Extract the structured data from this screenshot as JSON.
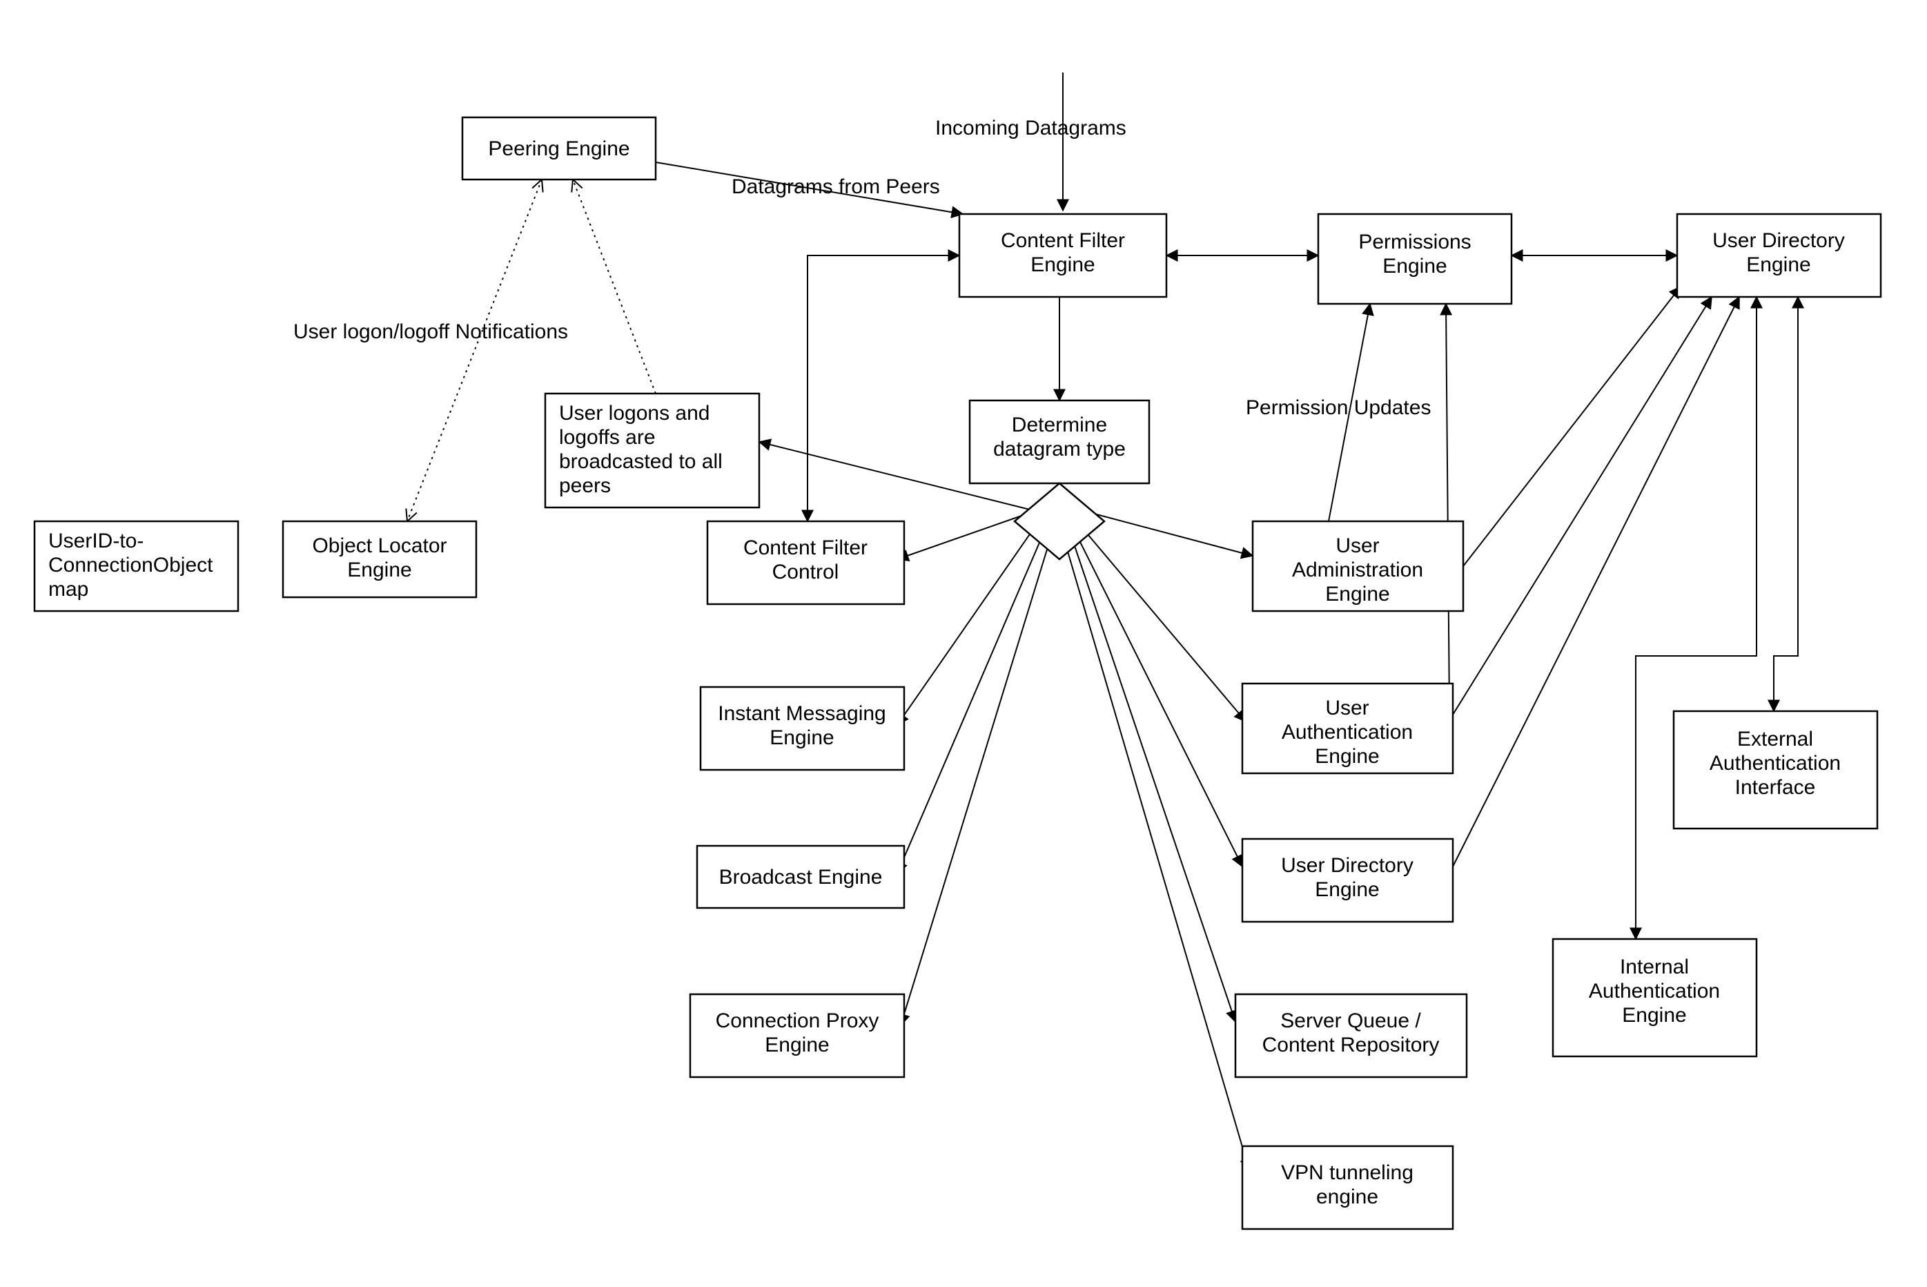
{
  "nodes": {
    "peering_engine": {
      "label": "Peering Engine"
    },
    "userid_map": {
      "label": "UserID-to-ConnectionObject map"
    },
    "object_locator": {
      "label": "Object Locator Engine"
    },
    "broadcast_note": {
      "label": "User logons and logoffs are broadcasted to all peers"
    },
    "content_filter_engine": {
      "label": "Content Filter Engine"
    },
    "permissions_engine": {
      "label": "Permissions Engine"
    },
    "user_directory_engine": {
      "label": "User Directory Engine"
    },
    "determine_type": {
      "label": "Determine datagram type"
    },
    "content_filter_ctrl": {
      "label": "Content Filter Control"
    },
    "user_admin_engine": {
      "label": "User Administration Engine"
    },
    "instant_messaging": {
      "label": "Instant Messaging Engine"
    },
    "user_auth_engine": {
      "label": "User Authentication Engine"
    },
    "broadcast_engine": {
      "label": "Broadcast Engine"
    },
    "user_dir_engine_2": {
      "label": "User Directory Engine"
    },
    "connection_proxy": {
      "label": "Connection Proxy Engine"
    },
    "server_queue": {
      "label": "Server Queue / Content Repository"
    },
    "vpn_engine": {
      "label": "VPN tunneling engine"
    },
    "external_auth": {
      "label": "External Authentication Interface"
    },
    "internal_auth": {
      "label": "Internal Authentication Engine"
    }
  },
  "labels": {
    "incoming_datagrams": "Incoming Datagrams",
    "datagrams_from_peers": "Datagrams from Peers",
    "user_logon_notif": "User logon/logoff Notifications",
    "permission_updates": "Permission Updates"
  },
  "chart_data": {
    "type": "flow-diagram",
    "nodes": [
      "Peering Engine",
      "UserID-to-ConnectionObject map",
      "Object Locator Engine",
      "User logons and logoffs are broadcasted to all peers",
      "Content Filter Engine",
      "Permissions Engine",
      "User Directory Engine",
      "Determine datagram type",
      "Content Filter Control",
      "User Administration Engine",
      "Instant Messaging Engine",
      "User Authentication Engine",
      "Broadcast Engine",
      "User Directory Engine (2)",
      "Connection Proxy Engine",
      "Server Queue / Content Repository",
      "VPN tunneling engine",
      "External Authentication Interface",
      "Internal Authentication Engine"
    ],
    "edges": [
      {
        "from": "(external)",
        "to": "Content Filter Engine",
        "label": "Incoming Datagrams",
        "direction": "→"
      },
      {
        "from": "Peering Engine",
        "to": "Content Filter Engine",
        "label": "Datagrams from Peers",
        "direction": "→"
      },
      {
        "from": "Content Filter Engine",
        "to": "Determine datagram type",
        "direction": "→"
      },
      {
        "from": "Content Filter Engine",
        "to": "Permissions Engine",
        "direction": "↔"
      },
      {
        "from": "Permissions Engine",
        "to": "User Directory Engine",
        "direction": "↔"
      },
      {
        "from": "Content Filter Control",
        "to": "Content Filter Engine",
        "direction": "↔"
      },
      {
        "from": "Determine datagram type",
        "to": "Content Filter Control",
        "direction": "→"
      },
      {
        "from": "Determine datagram type",
        "to": "Instant Messaging Engine",
        "direction": "→"
      },
      {
        "from": "Determine datagram type",
        "to": "Broadcast Engine",
        "direction": "→"
      },
      {
        "from": "Determine datagram type",
        "to": "Connection Proxy Engine",
        "direction": "→"
      },
      {
        "from": "Determine datagram type",
        "to": "User Administration Engine",
        "direction": "→"
      },
      {
        "from": "Determine datagram type",
        "to": "User Authentication Engine",
        "direction": "→"
      },
      {
        "from": "Determine datagram type",
        "to": "User Directory Engine (2)",
        "direction": "→"
      },
      {
        "from": "Determine datagram type",
        "to": "Server Queue / Content Repository",
        "direction": "→"
      },
      {
        "from": "Determine datagram type",
        "to": "VPN tunneling engine",
        "direction": "→"
      },
      {
        "from": "Determine datagram type",
        "to": "User logons and logoffs are broadcasted to all peers",
        "direction": "→"
      },
      {
        "from": "User Administration Engine",
        "to": "Permissions Engine",
        "label": "Permission Updates",
        "direction": "→"
      },
      {
        "from": "User Administration Engine",
        "to": "User Directory Engine",
        "direction": "→"
      },
      {
        "from": "User Authentication Engine",
        "to": "Permissions Engine",
        "direction": "→"
      },
      {
        "from": "User Authentication Engine",
        "to": "User Directory Engine",
        "direction": "→"
      },
      {
        "from": "User Directory Engine (2)",
        "to": "User Directory Engine",
        "direction": "→"
      },
      {
        "from": "User Directory Engine",
        "to": "External Authentication Interface",
        "direction": "↔"
      },
      {
        "from": "User Directory Engine",
        "to": "Internal Authentication Engine",
        "direction": "↔"
      },
      {
        "from": "Peering Engine",
        "to": "Object Locator Engine",
        "label": "User logon/logoff Notifications",
        "direction": "↔",
        "style": "dotted"
      },
      {
        "from": "User logons and logoffs are broadcasted to all peers",
        "to": "Peering Engine",
        "direction": "→",
        "style": "dotted"
      }
    ]
  }
}
